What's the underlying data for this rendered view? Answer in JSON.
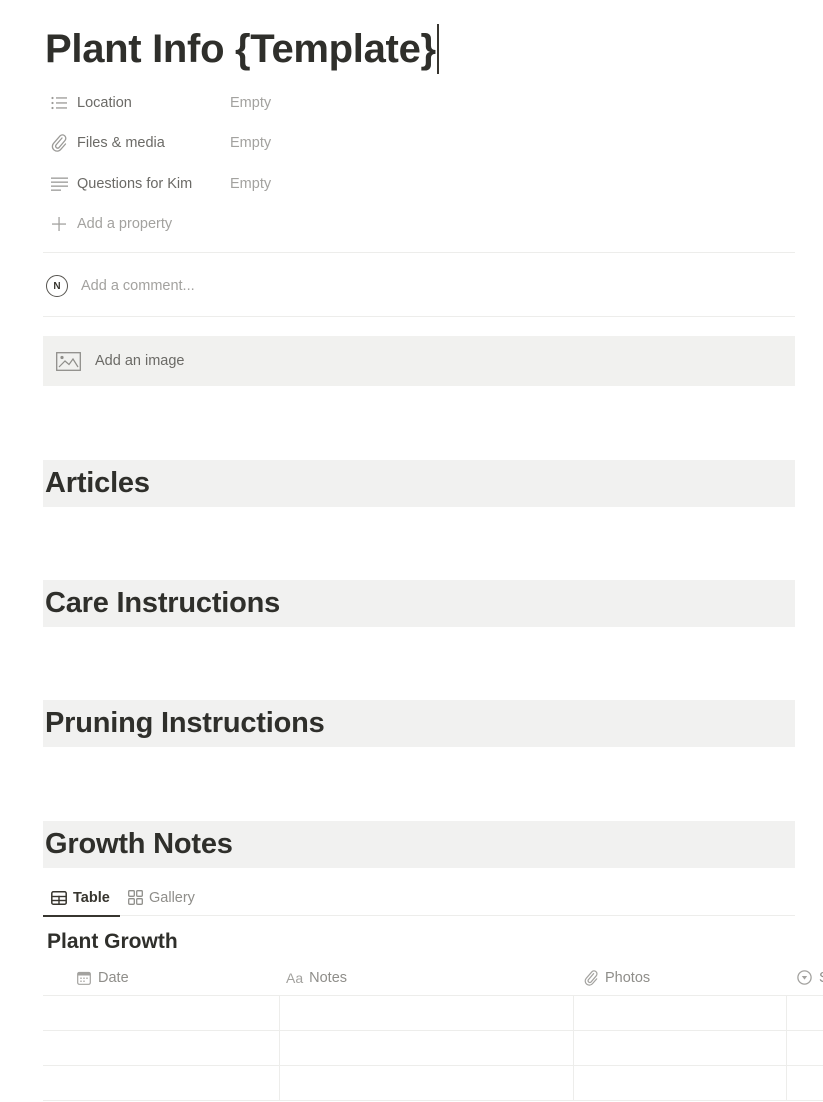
{
  "page": {
    "title": "Plant Info {Template}"
  },
  "properties": [
    {
      "icon": "list-icon",
      "label": "Location",
      "value": "Empty"
    },
    {
      "icon": "paperclip-icon",
      "label": "Files & media",
      "value": "Empty"
    },
    {
      "icon": "text-lines-icon",
      "label": "Questions for Kim",
      "value": "Empty"
    }
  ],
  "add_property": {
    "icon": "plus-icon",
    "label": "Add a property"
  },
  "comment": {
    "avatar_initial": "N",
    "placeholder": "Add a comment..."
  },
  "add_image": {
    "icon": "image-icon",
    "label": "Add an image"
  },
  "headings": [
    {
      "text": "Articles"
    },
    {
      "text": "Care Instructions"
    },
    {
      "text": "Pruning Instructions"
    },
    {
      "text": "Growth Notes"
    }
  ],
  "database": {
    "tabs": [
      {
        "icon": "table-icon",
        "label": "Table",
        "active": true
      },
      {
        "icon": "gallery-icon",
        "label": "Gallery",
        "active": false
      }
    ],
    "title": "Plant Growth",
    "columns": [
      {
        "icon": "calendar-icon",
        "label": "Date"
      },
      {
        "icon": "text-aa-icon",
        "icon_text": "Aa",
        "label": "Notes"
      },
      {
        "icon": "paperclip-icon",
        "label": "Photos"
      },
      {
        "icon": "select-icon",
        "label": "S"
      }
    ],
    "rows": [
      [
        "",
        "",
        "",
        ""
      ],
      [
        "",
        "",
        "",
        ""
      ],
      [
        "",
        "",
        "",
        ""
      ]
    ]
  },
  "colors": {
    "heading_bg": "#f1f1f0",
    "image_block_bg": "#f1f1ef",
    "text_primary": "#37352f",
    "text_muted": "#a3a29f"
  }
}
